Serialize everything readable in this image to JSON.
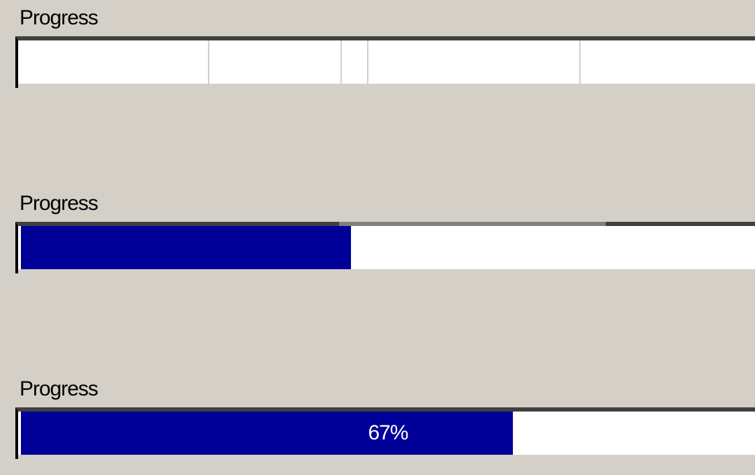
{
  "progress_bars": [
    {
      "label": "Progress",
      "style": "segmented-empty",
      "value_fraction": 0.0
    },
    {
      "label": "Progress",
      "style": "solid",
      "value_fraction": 0.45
    },
    {
      "label": "Progress",
      "style": "solid-with-text",
      "value_fraction": 0.67,
      "value_text": "67%"
    }
  ],
  "colors": {
    "fill": "#000099",
    "track": "#ffffff",
    "background": "#d4d0c8",
    "text_on_fill": "#ffffff"
  }
}
